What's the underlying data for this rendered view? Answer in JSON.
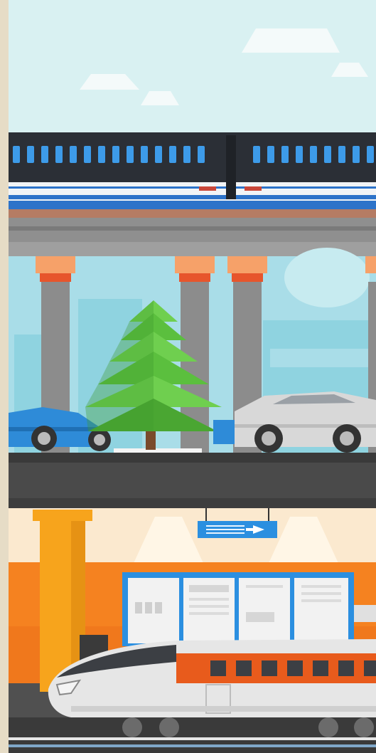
{
  "scene": {
    "description_colors": {
      "sky": "#d9f1f2",
      "skyline": "#8fd3e0",
      "pillar": "#8c8c8c",
      "pillar_cap": "#f39c5a",
      "pillar_band": "#e7552c",
      "track": "#8f8f8f",
      "road": "#4a4a4a",
      "platform_back": "#fbe9cf",
      "station_orange": "#f58220",
      "highspeed_train_body": "#e6e6e6",
      "highspeed_train_stripe": "#e85b1c",
      "metro_train_body": "#2b2f36",
      "metro_stripe": "#2d73c9",
      "tree_green": "#5bbf3e",
      "car_blue": "#2e8bd8",
      "car_white": "#d8d8d8",
      "sign_blue": "#2b8fe0",
      "border_beige": "#e6dcc6"
    },
    "icons": [
      "cloud-icon",
      "metro-train-icon",
      "tree-icon",
      "car-icon",
      "direction-sign-icon",
      "high-speed-train-icon"
    ]
  }
}
